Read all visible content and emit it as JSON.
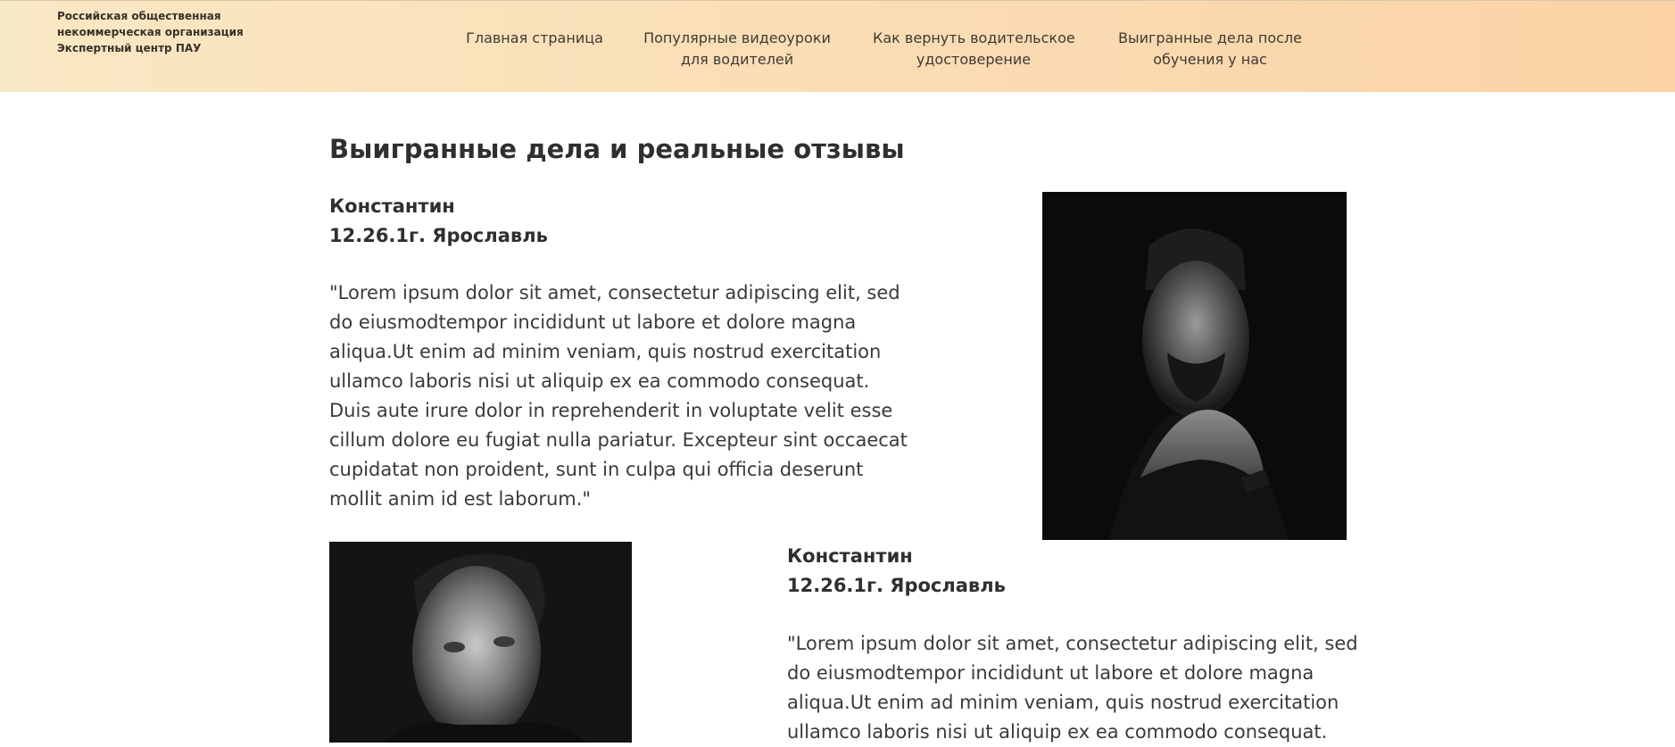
{
  "header": {
    "org_lines": [
      "Российская общественная",
      "некоммерческая организация",
      "Экспертный центр ПАУ"
    ],
    "nav": [
      {
        "lines": [
          "Главная страница"
        ]
      },
      {
        "lines": [
          "Популярные видеоуроки",
          "для водителей"
        ]
      },
      {
        "lines": [
          "Как вернуть водительское",
          "удостоверение"
        ]
      },
      {
        "lines": [
          "Выигранные дела после",
          "обучения у нас"
        ]
      }
    ]
  },
  "main": {
    "title": "Выигранные дела и реальные отзывы",
    "reviews": [
      {
        "name": "Константин",
        "case": "12.26.1г. Ярославль",
        "quote_lines": [
          "\"Lorem ipsum dolor sit amet, consectetur adipiscing elit, sed",
          "do eiusmodtempor incididunt ut labore et dolore magna",
          "aliqua.Ut enim ad minim veniam, quis nostrud exercitation",
          "ullamco laboris nisi ut aliquip ex ea commodo consequat.",
          "Duis aute irure dolor in reprehenderit in voluptate velit esse",
          "cillum dolore eu fugiat nulla pariatur. Excepteur sint occaecat",
          "cupidatat non proident, sunt in culpa qui officia deserunt",
          "mollit anim id est laborum.\""
        ]
      },
      {
        "name": "Константин",
        "case": "12.26.1г. Ярославль",
        "quote_lines": [
          "\"Lorem ipsum dolor sit amet, consectetur adipiscing elit, sed",
          "do eiusmodtempor incididunt ut labore et dolore magna",
          "aliqua.Ut enim ad minim veniam, quis nostrud exercitation",
          "ullamco laboris nisi ut aliquip ex ea commodo consequat."
        ]
      }
    ]
  }
}
